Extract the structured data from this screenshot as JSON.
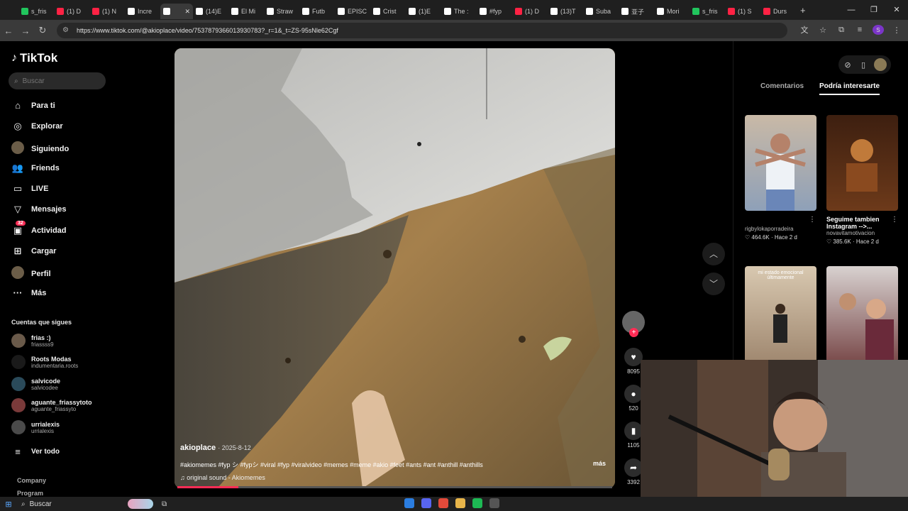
{
  "browser": {
    "tabs": [
      {
        "label": "s_fris",
        "color": "#21c55d"
      },
      {
        "label": "(1) D",
        "color": "#ff2244"
      },
      {
        "label": "(1) N",
        "color": "#ff2244"
      },
      {
        "label": "Incre",
        "color": "#ffffff"
      },
      {
        "label": "",
        "color": "#ffffff",
        "active": true
      },
      {
        "label": "(14)E",
        "color": "#ffffff"
      },
      {
        "label": "El Mi",
        "color": "#ffffff"
      },
      {
        "label": "Straw",
        "color": "#ffffff"
      },
      {
        "label": "Futb",
        "color": "#ffffff"
      },
      {
        "label": "EPISC",
        "color": "#ffffff"
      },
      {
        "label": "Crist",
        "color": "#ffffff"
      },
      {
        "label": "(1)E",
        "color": "#ffffff"
      },
      {
        "label": "The :",
        "color": "#ffffff"
      },
      {
        "label": "#fyp",
        "color": "#ffffff"
      },
      {
        "label": "(1) D",
        "color": "#ff2244"
      },
      {
        "label": "(13)T",
        "color": "#ffffff"
      },
      {
        "label": "Suba",
        "color": "#ffffff"
      },
      {
        "label": "亚子",
        "color": "#ffffff"
      },
      {
        "label": "Mori",
        "color": "#ffffff"
      },
      {
        "label": "s_fris",
        "color": "#21c55d"
      },
      {
        "label": "(1) S",
        "color": "#ff2244"
      },
      {
        "label": "Durs",
        "color": "#ff2244"
      }
    ],
    "new_tab": "+",
    "url": "https://www.tiktok.com/@akioplace/video/7537879366013930783?_r=1&_t=ZS-95sNle62Cgf"
  },
  "sidebar": {
    "logo": "TikTok",
    "search_placeholder": "Buscar",
    "nav": [
      {
        "label": "Para ti",
        "icon": "home-icon",
        "glyph": "⌂"
      },
      {
        "label": "Explorar",
        "icon": "compass-icon",
        "glyph": "◎"
      },
      {
        "label": "Siguiendo",
        "icon": "following-avatar-icon",
        "glyph": ""
      },
      {
        "label": "Friends",
        "icon": "friends-icon",
        "glyph": "👥"
      },
      {
        "label": "LIVE",
        "icon": "live-icon",
        "glyph": "▭"
      },
      {
        "label": "Mensajes",
        "icon": "messages-icon",
        "glyph": "▽"
      },
      {
        "label": "Actividad",
        "icon": "activity-icon",
        "glyph": "▣",
        "badge": "32"
      },
      {
        "label": "Cargar",
        "icon": "upload-icon",
        "glyph": "⊞"
      },
      {
        "label": "Perfil",
        "icon": "profile-avatar-icon",
        "glyph": ""
      },
      {
        "label": "Más",
        "icon": "more-icon",
        "glyph": "···"
      }
    ],
    "following_title": "Cuentas que sigues",
    "following": [
      {
        "name": "frias :)",
        "handle": "friassss9"
      },
      {
        "name": "Roots Modas",
        "handle": "indumentaria.roots"
      },
      {
        "name": "salvicode",
        "handle": "salvicodee"
      },
      {
        "name": "aguante_friassytoto",
        "handle": "aguante_friassyto"
      },
      {
        "name": "urrialexis",
        "handle": "urrialexis"
      }
    ],
    "see_all": "Ver todo",
    "footer": [
      "Company",
      "Program"
    ]
  },
  "video": {
    "author": "akioplace",
    "date": "2025-8-12",
    "description": "#akiomemes #fyp シ #fypシ #viral #fyp #viralvideo #memes #meme #akio #feet #ants #ant #anthill #anthills",
    "more": "más",
    "sound": "original sound - Akiomemes",
    "progress": 0.14
  },
  "actions": {
    "likes": "8095",
    "comments": "520",
    "saves": "1105",
    "shares": "3392"
  },
  "right_panel": {
    "tabs": [
      "Comentarios",
      "Podría interesarte"
    ],
    "suggestions": [
      {
        "title": "",
        "author": "rigbylokaporradeira",
        "stats": "♡ 464.6K · Hace 2 d"
      },
      {
        "title": "Seguime tambien Instagram -->...",
        "author": "novavitamotivacion",
        "stats": "♡ 385.6K · Hace 2 d"
      },
      {
        "title": "mi estado emocional últimamente",
        "author": "",
        "stats": ""
      },
      {
        "title": "",
        "author": "",
        "stats": ""
      }
    ]
  },
  "taskbar": {
    "search_label": "Buscar"
  }
}
